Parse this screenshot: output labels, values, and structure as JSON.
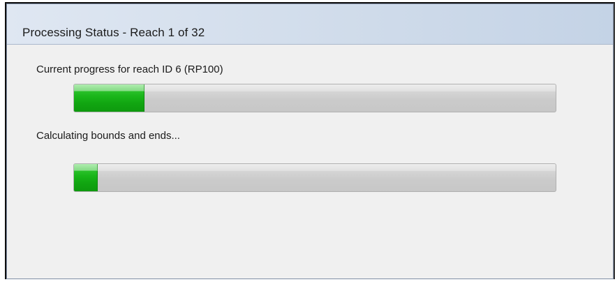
{
  "dialog": {
    "title": "Processing Status - Reach 1 of 32"
  },
  "progress_primary": {
    "label": "Current progress for reach ID 6 (RP100)",
    "fraction": 0.145
  },
  "progress_secondary": {
    "label": "Calculating bounds and ends...",
    "fraction": 0.048
  },
  "colors": {
    "progress_fill": "#19b519",
    "progress_track": "#cbcbcb",
    "titlebar": "#cfdbea",
    "dialog_background": "#f0f0f0"
  }
}
